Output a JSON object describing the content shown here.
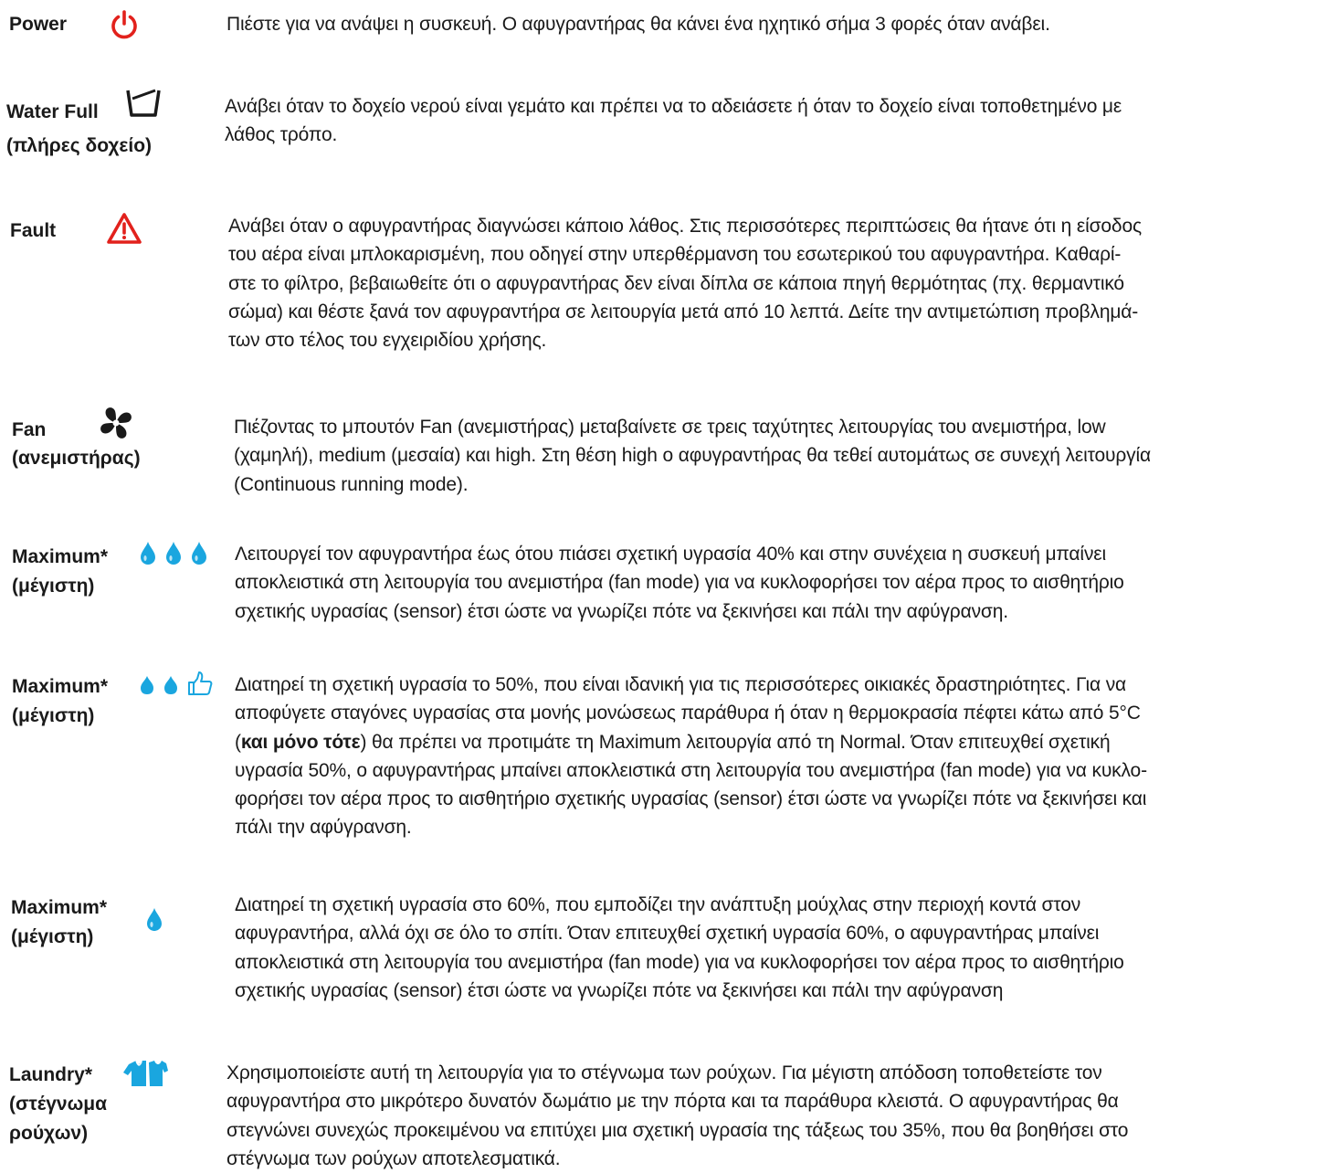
{
  "colors": {
    "red": "#e2211c",
    "blue": "#1aa6df",
    "black": "#1a1a1a"
  },
  "rows": [
    {
      "label_lines": [
        "Power"
      ],
      "icon": "power-icon",
      "lines": [
        "Πιέστε για να ανάψει η συσκευή. Ο αφυγραντήρας θα κάνει ένα ηχητικό σήμα 3 φορές όταν ανάβει."
      ]
    },
    {
      "label_lines": [
        "Water Full",
        "(πλήρες δοχείο)"
      ],
      "icon": "water-tank-icon",
      "lines": [
        "Ανάβει όταν το δοχείο νερού είναι γεμάτο και πρέπει να το αδειάσετε ή όταν το δοχείο είναι τοποθετημένο με",
        "λάθος τρόπο."
      ]
    },
    {
      "label_lines": [
        "Fault"
      ],
      "icon": "warning-triangle-icon",
      "lines": [
        "Ανάβει όταν ο αφυγραντήρας διαγνώσει κάποιο λάθος. Στις περισσότερες περιπτώσεις θα ήτανε ότι η είσοδος",
        "του αέρα είναι μπλοκαρισμένη, που οδηγεί στην υπερθέρμανση του εσωτερικού του αφυγραντήρα. Καθαρί-",
        "στε το φίλτρο, βεβαιωθείτε ότι ο αφυγραντήρας δεν είναι δίπλα σε κάποια πηγή θερμότητας (πχ. θερμαντικό",
        "σώμα) και θέστε ξανά τον αφυγραντήρα σε λειτουργία μετά από 10 λεπτά. Δείτε την αντιμετώπιση προβλημά-",
        "των στο τέλος του εγχειριδίου χρήσης."
      ]
    },
    {
      "label_lines": [
        "Fan",
        "(ανεμιστήρας)"
      ],
      "icon": "fan-icon",
      "lines": [
        "Πιέζοντας το μπουτόν Fan (ανεμιστήρας) μεταβαίνετε σε τρεις ταχύτητες λειτουργίας του ανεμιστήρα, low",
        "(χαμηλή), medium (μεσαία) και high. Στη θέση high ο αφυγραντήρας θα τεθεί αυτομάτως σε συνεχή λειτουργία",
        "(Continuous running mode)."
      ]
    },
    {
      "label_lines": [
        "Maximum*",
        "(μέγιστη)"
      ],
      "icon": "three-drops-icon",
      "lines": [
        "Λειτουργεί τον αφυγραντήρα έως ότου πιάσει σχετική υγρασία 40% και στην συνέχεια η συσκευή μπαίνει",
        "αποκλειστικά στη λειτουργία του ανεμιστήρα (fan mode) για να κυκλοφορήσει τον αέρα προς το αισθητήριο",
        "σχετικής υγρασίας (sensor) έτσι ώστε να γνωρίζει πότε να ξεκινήσει και πάλι την αφύγρανση."
      ]
    },
    {
      "label_lines": [
        "Maximum*",
        "(μέγιστη)"
      ],
      "icon": "two-drops-thumbs-up-icon",
      "lines": [
        "Διατηρεί τη σχετική υγρασία το 50%, που είναι ιδανική για τις περισσότερες οικιακές δραστηριότητες. Για να",
        "αποφύγετε σταγόνες υγρασίας στα μονής μονώσεως παράθυρα ή όταν η θερμοκρασία πέφτει κάτω από 5°C"
      ],
      "line3_open": "(",
      "line3_bold": "και μόνο τότε",
      "line3_rest": ") θα πρέπει να προτιμάτε τη Maximum λειτουργία από τη Normal. Όταν επιτευχθεί σχετική",
      "lines_after": [
        "υγρασία 50%, ο αφυγραντήρας μπαίνει αποκλειστικά στη λειτουργία του ανεμιστήρα (fan mode) για να κυκλο-",
        "φορήσει τον αέρα προς το αισθητήριο σχετικής υγρασίας (sensor) έτσι ώστε να γνωρίζει πότε να ξεκινήσει και",
        "πάλι την αφύγρανση."
      ]
    },
    {
      "label_lines": [
        "Maximum*",
        "(μέγιστη)"
      ],
      "icon": "single-drop-icon",
      "lines": [
        "Διατηρεί τη σχετική υγρασία στο 60%, που εμποδίζει την ανάπτυξη μούχλας στην περιοχή κοντά στον",
        "αφυγραντήρα, αλλά όχι σε όλο το σπίτι. Όταν επιτευχθεί σχετική υγρασία 60%, ο αφυγραντήρας μπαίνει",
        "αποκλειστικά στη λειτουργία του ανεμιστήρα (fan mode) για να κυκλοφορήσει τον αέρα προς το αισθητήριο",
        "σχετικής υγρασίας (sensor) έτσι ώστε να γνωρίζει πότε να ξεκινήσει και πάλι την αφύγρανση"
      ]
    },
    {
      "label_lines": [
        "Laundry*",
        "(στέγνωμα",
        "ρούχων)"
      ],
      "icon": "shirt-icon",
      "lines": [
        "Χρησιμοποιείστε αυτή τη λειτουργία για το στέγνωμα των ρούχων. Για μέγιστη απόδοση τοποθετείστε τον",
        "αφυγραντήρα στο μικρότερο δυνατόν δωμάτιο με την πόρτα και τα παράθυρα κλειστά. Ο αφυγραντήρας θα",
        "στεγνώνει συνεχώς προκειμένου να επιτύχει μια σχετική υγρασία της τάξεως του 35%, που θα βοηθήσει στο",
        "στέγνωμα των ρούχων αποτελεσματικά."
      ]
    }
  ]
}
